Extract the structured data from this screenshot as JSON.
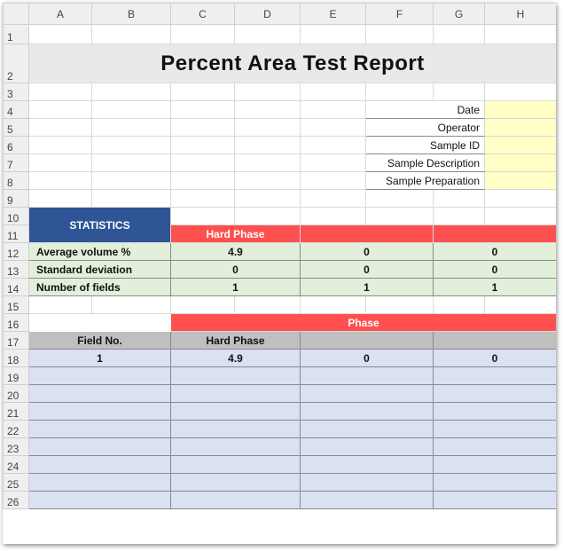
{
  "columns": [
    "A",
    "B",
    "C",
    "D",
    "E",
    "F",
    "G",
    "H"
  ],
  "rows": [
    "1",
    "2",
    "3",
    "4",
    "5",
    "6",
    "7",
    "8",
    "9",
    "10",
    "11",
    "12",
    "13",
    "14",
    "15",
    "16",
    "17",
    "18",
    "19",
    "20",
    "21",
    "22",
    "23",
    "24",
    "25",
    "26"
  ],
  "title": "Percent Area Test Report",
  "info_fields": [
    "Date",
    "Operator",
    "Sample ID",
    "Sample Description",
    "Sample Preparation"
  ],
  "statistics": {
    "header": "STATISTICS",
    "phase_header": "Hard Phase",
    "rows": [
      {
        "label": "Average volume %",
        "values": [
          "4.9",
          "0",
          "0"
        ]
      },
      {
        "label": "Standard deviation",
        "values": [
          "0",
          "0",
          "0"
        ]
      },
      {
        "label": "Number of fields",
        "values": [
          "1",
          "1",
          "1"
        ]
      }
    ]
  },
  "phase_table": {
    "phase_label": "Phase",
    "field_no_header": "Field No.",
    "phase_col_header": "Hard Phase",
    "first_row": [
      "1",
      "4.9",
      "0",
      "0"
    ]
  },
  "colors": {
    "stats_header": "#2f5597",
    "phase_red": "#ff5050",
    "stats_green": "#e2efda",
    "data_blue": "#d9e1f2",
    "input_yellow": "#ffffc6"
  }
}
